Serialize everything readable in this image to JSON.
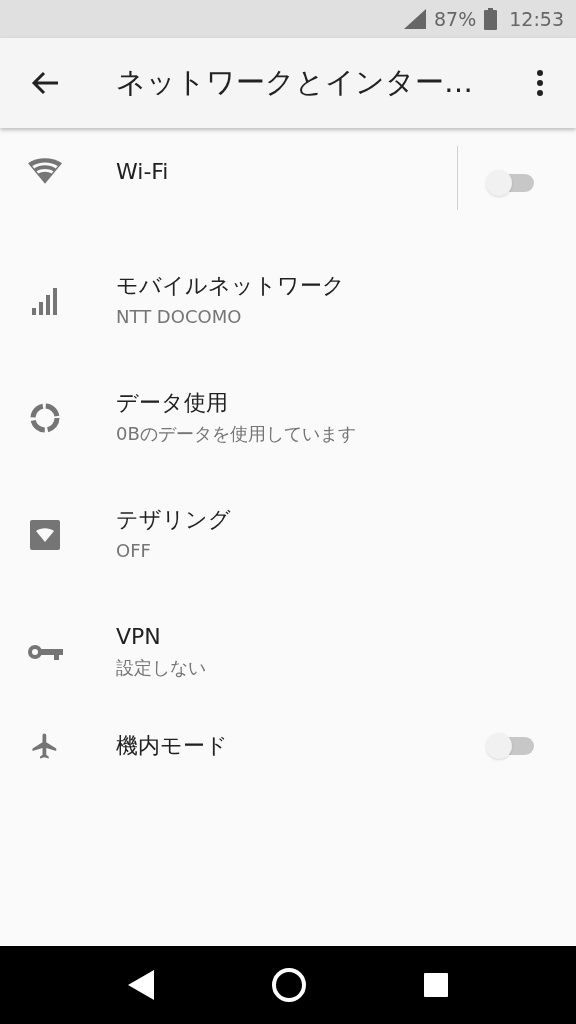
{
  "status_bar": {
    "battery": "87%",
    "time": "12:53"
  },
  "app_bar": {
    "title": "ネットワークとインター…"
  },
  "items": [
    {
      "kind": "split_toggle",
      "title": "Wi-Fi",
      "on": false
    },
    {
      "kind": "link",
      "title": "モバイルネットワーク",
      "subtitle": "NTT DOCOMO"
    },
    {
      "kind": "link",
      "title": "データ使用",
      "subtitle": "0Bのデータを使用しています"
    },
    {
      "kind": "link",
      "title": "テザリング",
      "subtitle": "OFF"
    },
    {
      "kind": "link",
      "title": "VPN",
      "subtitle": "設定しない"
    },
    {
      "kind": "toggle",
      "title": "機内モード",
      "on": false
    }
  ]
}
